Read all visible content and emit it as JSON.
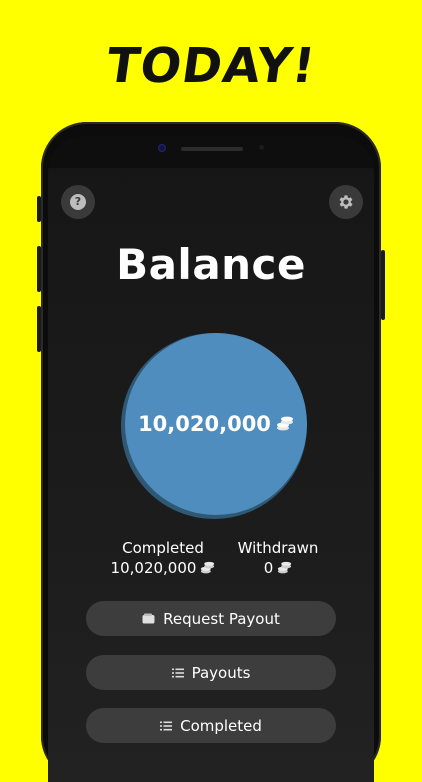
{
  "headline": "TODAY!",
  "app": {
    "title": "Balance",
    "help_glyph": "?",
    "balance_value": "10,020,000",
    "stats": {
      "completed_label": "Completed",
      "completed_value": "10,020,000",
      "withdrawn_label": "Withdrawn",
      "withdrawn_value": "0"
    },
    "buttons": {
      "request_payout": "Request Payout",
      "payouts": "Payouts",
      "completed": "Completed"
    },
    "icons": {
      "help": "question-icon",
      "settings": "gear-icon",
      "currency": "coins-icon",
      "wallet": "wallet-icon",
      "list": "list-icon"
    },
    "colors": {
      "background": "#FFFF00",
      "balance_circle": "#4F8DBE",
      "button": "#3D3D3D"
    }
  }
}
